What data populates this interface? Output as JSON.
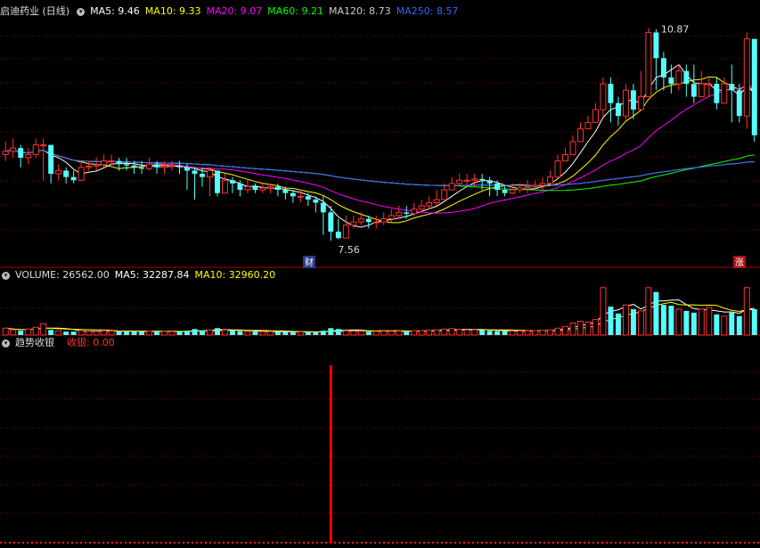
{
  "colors": {
    "up": "#ff3333",
    "down": "#55ffff",
    "grid": "#8b0000",
    "ma5": "#ffffff",
    "ma10": "#ffff00",
    "ma20": "#ff00ff",
    "ma60": "#00ff00",
    "ma120": "#cccccc",
    "ma250": "#3366ff",
    "signal": "#ff0000"
  },
  "price_panel": {
    "title": "启迪药业 (日线)",
    "ma_labels": [
      {
        "text": "MA5: 9.46",
        "color": "#ffffff"
      },
      {
        "text": "MA10: 9.33",
        "color": "#ffff00"
      },
      {
        "text": "MA20: 9.07",
        "color": "#ff00ff"
      },
      {
        "text": "MA60: 9.21",
        "color": "#00ff00"
      },
      {
        "text": "MA120: 8.73",
        "color": "#cccccc"
      },
      {
        "text": "MA250: 8.57",
        "color": "#3366ff"
      }
    ],
    "high_label": "10.87",
    "low_label": "7.56",
    "tag_cai": "财",
    "tag_zhang": "涨"
  },
  "volume_panel": {
    "label": "VOLUME: 26562.00",
    "ma5": "MA5: 32287.84",
    "ma10": "MA10: 32960.20"
  },
  "indicator_panel": {
    "name": "趋势收银",
    "series_label": "收银: 0.00"
  },
  "chart_data": [
    {
      "type": "candlestick",
      "title": "启迪药业 (日线)",
      "ylim": [
        7.2,
        11.0
      ],
      "closes": [
        8.95,
        9.0,
        8.85,
        8.9,
        9.05,
        9.05,
        8.6,
        8.65,
        8.55,
        8.5,
        8.7,
        8.72,
        8.74,
        8.8,
        8.8,
        8.75,
        8.73,
        8.7,
        8.68,
        8.75,
        8.7,
        8.72,
        8.73,
        8.7,
        8.65,
        8.6,
        8.55,
        8.65,
        8.3,
        8.5,
        8.45,
        8.35,
        8.4,
        8.35,
        8.38,
        8.4,
        8.35,
        8.3,
        8.25,
        8.25,
        8.2,
        8.15,
        8.0,
        7.7,
        7.6,
        7.8,
        7.85,
        7.9,
        7.85,
        7.85,
        7.9,
        7.95,
        8.0,
        7.98,
        8.05,
        8.1,
        8.15,
        8.2,
        8.35,
        8.45,
        8.5,
        8.5,
        8.52,
        8.5,
        8.45,
        8.35,
        8.3,
        8.35,
        8.38,
        8.4,
        8.42,
        8.45,
        8.55,
        8.8,
        8.9,
        9.1,
        9.3,
        9.4,
        9.6,
        10.0,
        9.7,
        9.5,
        9.9,
        9.6,
        9.8,
        10.8,
        10.4,
        10.1,
        10.0,
        10.2,
        10.0,
        9.8,
        10.0,
        10.0,
        9.7,
        10.0,
        9.9,
        9.5,
        10.7,
        9.2
      ],
      "lows": [
        8.8,
        8.85,
        8.7,
        8.75,
        8.85,
        8.5,
        8.45,
        8.5,
        8.45,
        8.45,
        8.6,
        8.65,
        8.65,
        8.7,
        8.7,
        8.65,
        8.65,
        8.6,
        8.6,
        8.65,
        8.6,
        8.6,
        8.65,
        8.6,
        8.35,
        8.2,
        8.4,
        8.25,
        8.25,
        8.3,
        8.3,
        8.25,
        8.3,
        8.3,
        8.3,
        8.3,
        8.25,
        8.2,
        8.15,
        8.15,
        8.1,
        8.0,
        7.65,
        7.56,
        7.58,
        7.7,
        7.75,
        7.8,
        7.75,
        7.75,
        7.8,
        7.85,
        7.9,
        7.9,
        7.95,
        8.0,
        8.05,
        8.1,
        8.2,
        8.35,
        8.4,
        8.4,
        8.4,
        8.35,
        8.25,
        8.25,
        8.25,
        8.28,
        8.3,
        8.3,
        8.35,
        8.35,
        8.45,
        8.7,
        8.8,
        9.0,
        9.1,
        9.3,
        9.45,
        9.5,
        9.4,
        9.35,
        9.45,
        9.45,
        9.6,
        9.9,
        9.9,
        9.9,
        9.85,
        9.9,
        9.8,
        9.7,
        9.8,
        9.8,
        9.6,
        9.7,
        9.4,
        9.4,
        9.3,
        9.1
      ],
      "highs": [
        9.1,
        9.15,
        9.05,
        9.0,
        9.15,
        9.15,
        8.95,
        8.75,
        8.7,
        8.65,
        8.8,
        8.8,
        8.85,
        8.9,
        8.9,
        8.85,
        8.85,
        8.8,
        8.8,
        8.85,
        8.8,
        8.8,
        8.8,
        8.8,
        8.75,
        8.7,
        8.7,
        8.7,
        8.6,
        8.6,
        8.55,
        8.5,
        8.5,
        8.45,
        8.45,
        8.45,
        8.45,
        8.4,
        8.35,
        8.35,
        8.3,
        8.25,
        8.25,
        8.1,
        7.9,
        7.95,
        7.95,
        8.0,
        7.95,
        7.95,
        8.0,
        8.05,
        8.1,
        8.1,
        8.15,
        8.2,
        8.25,
        8.35,
        8.45,
        8.55,
        8.6,
        8.6,
        8.6,
        8.6,
        8.55,
        8.5,
        8.4,
        8.45,
        8.45,
        8.5,
        8.5,
        8.55,
        8.65,
        8.9,
        9.0,
        9.2,
        9.4,
        9.5,
        9.7,
        10.1,
        10.1,
        9.8,
        10.0,
        10.0,
        10.2,
        10.87,
        10.85,
        10.5,
        10.3,
        10.3,
        10.3,
        10.3,
        10.2,
        10.1,
        10.1,
        10.1,
        10.3,
        10.0,
        10.8,
        10.6
      ]
    },
    {
      "type": "bar",
      "title": "VOLUME",
      "values": [
        8000,
        6000,
        5000,
        7000,
        9000,
        13000,
        6000,
        5000,
        4000,
        4000,
        5000,
        4500,
        4000,
        5000,
        4800,
        4500,
        4200,
        4000,
        4200,
        4600,
        4100,
        4300,
        4000,
        3900,
        5000,
        7000,
        5000,
        6000,
        8000,
        6000,
        5000,
        4500,
        4000,
        4000,
        3800,
        4000,
        3900,
        3700,
        3500,
        3600,
        3400,
        3500,
        5000,
        8000,
        7000,
        5000,
        4500,
        4500,
        4000,
        4200,
        4500,
        4400,
        4600,
        4500,
        5000,
        5200,
        5500,
        6000,
        7000,
        7500,
        6500,
        6000,
        6200,
        5800,
        5000,
        4500,
        4500,
        4600,
        4800,
        5000,
        5200,
        5500,
        6000,
        8000,
        10000,
        14000,
        16000,
        15000,
        18000,
        55000,
        33000,
        25000,
        35000,
        30000,
        28000,
        55000,
        50000,
        35000,
        34000,
        30000,
        28000,
        26000,
        30000,
        32000,
        24000,
        22000,
        26000,
        22000,
        55000,
        30000
      ],
      "ylim": [
        0,
        60000
      ]
    },
    {
      "type": "bar",
      "title": "趋势收银",
      "signal_index": 43,
      "ylim": [
        0,
        1
      ]
    }
  ]
}
